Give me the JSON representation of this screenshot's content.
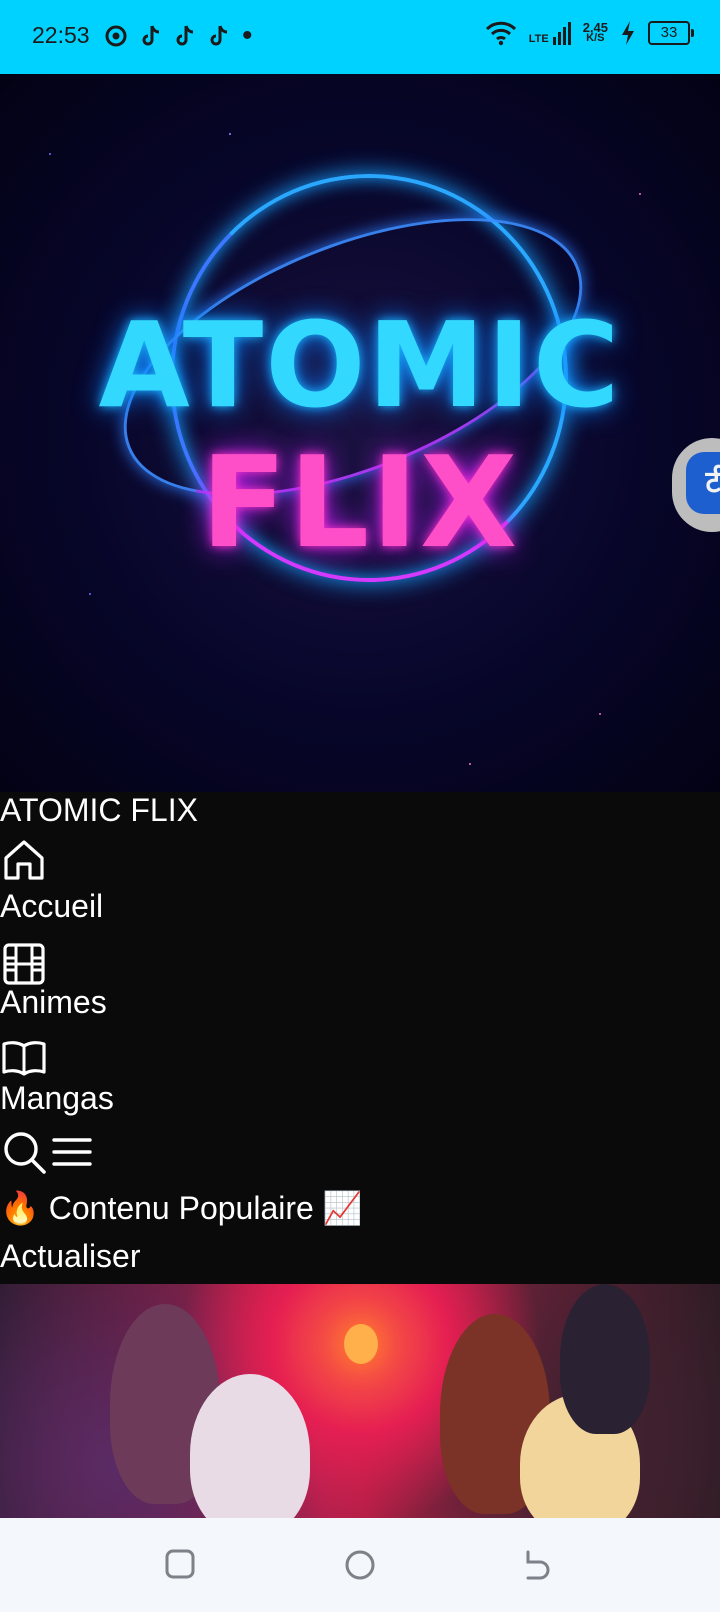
{
  "status_bar": {
    "time": "22:53",
    "net_type": "LTE",
    "net_speed_value": "2,45",
    "net_speed_unit": "K/S",
    "battery": "33"
  },
  "hero": {
    "logo_line1": "ATOMIC",
    "logo_line2": "FLIX",
    "floating_button_glyph": "टी"
  },
  "app": {
    "title": "ATOMIC FLIX",
    "nav": [
      {
        "label": "Accueil",
        "icon": "home-icon"
      },
      {
        "label": "Animes",
        "icon": "film-icon"
      },
      {
        "label": "Mangas",
        "icon": "book-icon"
      }
    ],
    "section_title": "🔥 Contenu Populaire 📈",
    "refresh_label": "Actualiser"
  },
  "colors": {
    "status_bar": "#00d2ff",
    "background": "#0a0a0a",
    "logo_cyan": "#33d8ff",
    "logo_pink": "#ff4fc8",
    "nav_bar": "#f4f7fb"
  }
}
